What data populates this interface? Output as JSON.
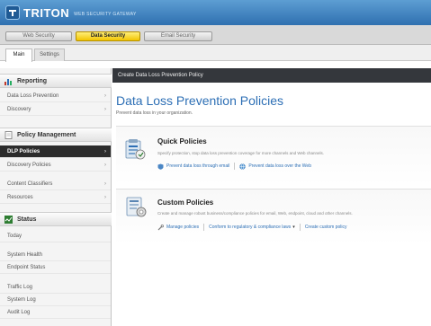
{
  "header": {
    "brand": "TRITON",
    "tagline": "WEB SECURITY GATEWAY"
  },
  "modules": [
    {
      "label": "Web Security",
      "active": false
    },
    {
      "label": "Data Security",
      "active": true
    },
    {
      "label": "Email Security",
      "active": false
    }
  ],
  "subtabs": [
    {
      "label": "Main",
      "active": true
    },
    {
      "label": "Settings",
      "active": false
    }
  ],
  "sidebar": {
    "reporting": {
      "title": "Reporting",
      "items": [
        "Data Loss Prevention",
        "Discovery"
      ]
    },
    "policy": {
      "title": "Policy Management",
      "items": [
        "DLP Policies",
        "Discovery Policies",
        "Content Classifiers",
        "Resources"
      ]
    },
    "status": {
      "title": "Status",
      "items": [
        "Today",
        "System Health",
        "Endpoint Status",
        "Traffic Log",
        "System Log",
        "Audit Log"
      ]
    }
  },
  "content": {
    "breadcrumb": "Create Data Loss Prevention Policy",
    "title": "Data Loss Prevention Policies",
    "subtitle": "Prevent data loss in your organization.",
    "quick": {
      "title": "Quick Policies",
      "desc": "Specify protection, stop data loss prevention coverage for more channels and Web channels.",
      "link1": "Prevent data loss through email",
      "link2": "Prevent data loss over the Web"
    },
    "custom": {
      "title": "Custom Policies",
      "desc": "Create and manage robust business/compliance policies for email, Web, endpoint, cloud and other channels.",
      "link1": "Manage policies",
      "link2": "Conform to regulatory & compliance laws",
      "link3": "Create custom policy"
    }
  },
  "colors": {
    "header": "#3f82c1",
    "active_module": "#f5cc1a",
    "selected_nav": "#2c2c2c",
    "title_blue": "#2d6fb5"
  }
}
